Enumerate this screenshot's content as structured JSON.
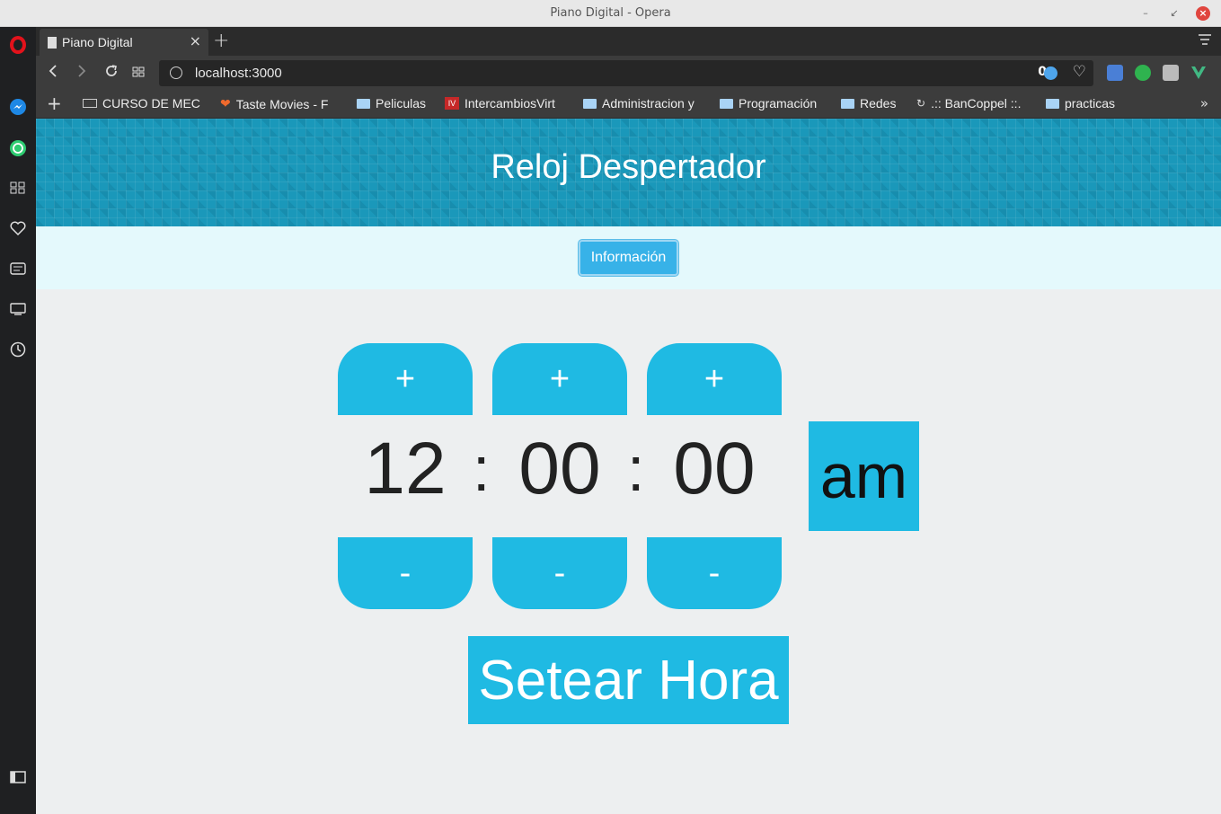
{
  "window": {
    "title": "Piano Digital - Opera",
    "controls": [
      "–",
      "↙",
      "×"
    ]
  },
  "tabs": [
    {
      "label": "Piano Digital",
      "close": "×"
    }
  ],
  "new_tab_label": "+",
  "address_bar": {
    "url": "localhost:3000",
    "adblock_count": "0"
  },
  "bookmarks": [
    {
      "label": "CURSO DE MEC",
      "icon": "page-icon"
    },
    {
      "label": "Taste Movies - F",
      "icon": "heart-icon"
    },
    {
      "label": "Peliculas",
      "icon": "folder-icon"
    },
    {
      "label": "IntercambiosVirt",
      "icon": "iv-icon"
    },
    {
      "label": "Administracion y",
      "icon": "folder-icon"
    },
    {
      "label": "Programación",
      "icon": "folder-icon"
    },
    {
      "label": "Redes",
      "icon": "folder-icon"
    },
    {
      "label": ".:: BanCoppel ::.",
      "icon": "loading-icon"
    },
    {
      "label": "practicas",
      "icon": "folder-icon"
    }
  ],
  "page": {
    "heading": "Reloj Despertador",
    "info_button": "Información",
    "time": {
      "hours": "12",
      "minutes": "00",
      "seconds": "00",
      "separator": ":",
      "period": "am"
    },
    "plus_label": "+",
    "minus_label": "-",
    "set_button": "Setear Hora"
  },
  "colors": {
    "accent": "#1fbae3",
    "header": "#1a98ba",
    "info_bar": "#e4f9fc",
    "page_bg": "#edeff0"
  }
}
